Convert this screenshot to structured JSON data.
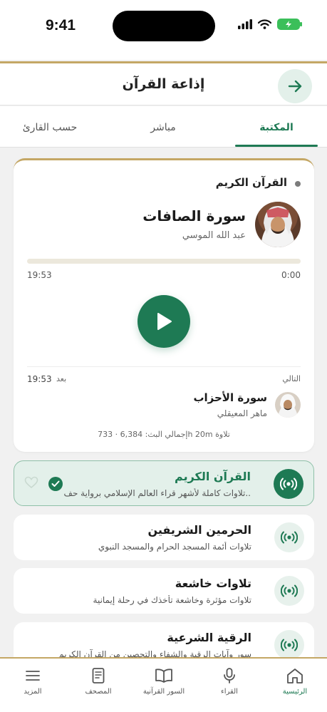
{
  "status_bar": {
    "time": "9:41"
  },
  "header": {
    "title": "إذاعة القرآن",
    "back_icon": "arrow-right-icon"
  },
  "tabs": [
    {
      "label": "المكتبة",
      "active": true
    },
    {
      "label": "مباشر",
      "active": false
    },
    {
      "label": "حسب القارئ",
      "active": false
    }
  ],
  "player": {
    "station": "القرآن الكريم",
    "surah": "سورة الصافات",
    "reciter": "عبد الله الموسي",
    "progress": 0,
    "time_elapsed": "0:00",
    "time_total": "19:53",
    "next_label": "التالي",
    "next_after_label": "بعد",
    "next_time": "19:53",
    "next_surah": "سورة الأحزاب",
    "next_reciter": "ماهر المعيقلي",
    "totals": "إجمالي البث: 6,384 · 733h 20m تلاوة"
  },
  "stations": [
    {
      "title": "القرآن الكريم",
      "desc": "تلاوات كاملة لأشهر قراء العالم الإسلامي برواية حف..",
      "active": true
    },
    {
      "title": "الحرمين الشريفين",
      "desc": "تلاوات أئمة المسجد الحرام والمسجد النبوي",
      "active": false
    },
    {
      "title": "تلاوات خاشعة",
      "desc": "تلاوات مؤثرة وخاشعة تأخذك في رحلة إيمانية",
      "active": false
    },
    {
      "title": "الرقية الشرعية",
      "desc": "سور وآيات الرقية والشفاء والتحصين من القرآن الكريم",
      "active": false
    }
  ],
  "bottom_nav": [
    {
      "label": "الرئيسية",
      "icon": "home-icon",
      "active": true
    },
    {
      "label": "القراء",
      "icon": "microphone-icon",
      "active": false
    },
    {
      "label": "السور القرآنية",
      "icon": "open-book-icon",
      "active": false
    },
    {
      "label": "المصحف",
      "icon": "mushaf-icon",
      "active": false
    },
    {
      "label": "المزيد",
      "icon": "menu-icon",
      "active": false
    }
  ],
  "colors": {
    "primary": "#1e7a54",
    "gold": "#c4a765",
    "background": "#f1f1f1"
  }
}
